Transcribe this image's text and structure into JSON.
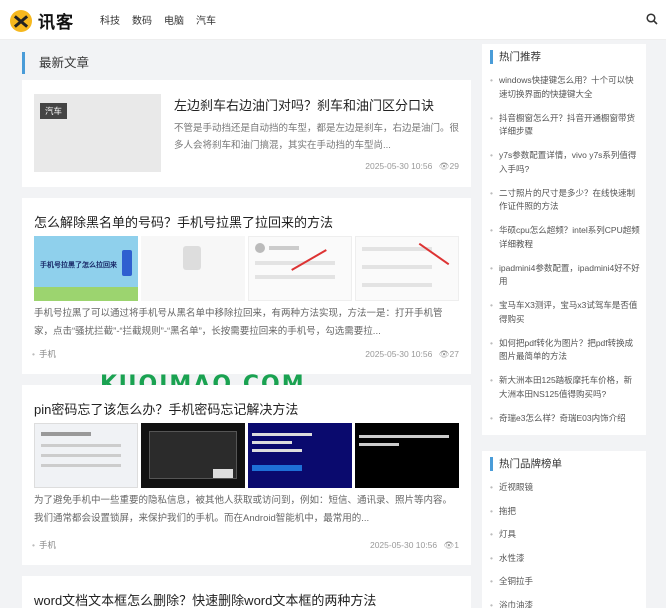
{
  "header": {
    "logo_text": "讯客",
    "nav": [
      "科技",
      "数码",
      "电脑",
      "汽车"
    ]
  },
  "section_title": "最新文章",
  "articles": [
    {
      "tag": "汽车",
      "title": "左边刹车右边油门对吗？刹车和油门区分口诀",
      "desc": "不管是手动挡还是自动挡的车型，都是左边是刹车，右边是油门。很多人会将刹车和油门搞混，其实在手动挡的车型尚...",
      "date": "2025-05-30 10:56",
      "views": "29"
    },
    {
      "title": "怎么解除黑名单的号码？手机号拉黑了拉回来的方法",
      "img_caption": "手机号拉黑了怎么拉回来",
      "desc": "手机号拉黑了可以通过将手机号从黑名单中移除拉回来，有两种方法实现，方法一是：打开手机管家，点击“骚扰拦截”-“拦截规则”-“黑名单”，长按需要拉回来的手机号，勾选需要拉...",
      "category": "手机",
      "date": "2025-05-30 10:56",
      "views": "27"
    },
    {
      "title": "pin密码忘了该怎么办？手机密码忘记解决方法",
      "desc": "为了避免手机中一些重要的隐私信息，被其他人获取或访问到，例如：短信、通讯录、照片等内容。我们通常都会设置锁屏，来保护我们的手机。而在Android智能机中，最常用的...",
      "category": "手机",
      "date": "2025-05-30 10:56",
      "views": "1"
    },
    {
      "title": "word文档文本框怎么删除？快速删除word文本框的两种方法"
    }
  ],
  "watermark": "KUQIMAO.COM",
  "sidebar_hot": {
    "title": "热门推荐",
    "items": [
      "windows快捷键怎么用？十个可以快速切换界面的快捷键大全",
      "抖音橱窗怎么开？抖音开通橱窗带货详细步骤",
      "y7s参数配置详情，vivo y7s系列值得入手吗?",
      "二寸照片的尺寸是多少？在线快速制作证件照的方法",
      "华硕cpu怎么超频？intel系列CPU超频详细教程",
      "ipadmini4参数配置，ipadmini4好不好用",
      "宝马车X3测评，宝马x3试驾车是否值得购买",
      "如何把pdf转化为图片？把pdf转换成图片最简单的方法",
      "新大洲本田125踏板摩托车价格，新大洲本田NS125值得购买吗?",
      "奇瑞e3怎么样？奇瑞E03内饰介绍"
    ]
  },
  "sidebar_brand": {
    "title": "热门品牌榜单",
    "items": [
      "近视眼镜",
      "拖把",
      "灯具",
      "水性漆",
      "全铜拉手",
      "浴巾油漆"
    ]
  },
  "colors": {
    "accent": "#4a9cd8",
    "watermark": "#1aa251"
  }
}
